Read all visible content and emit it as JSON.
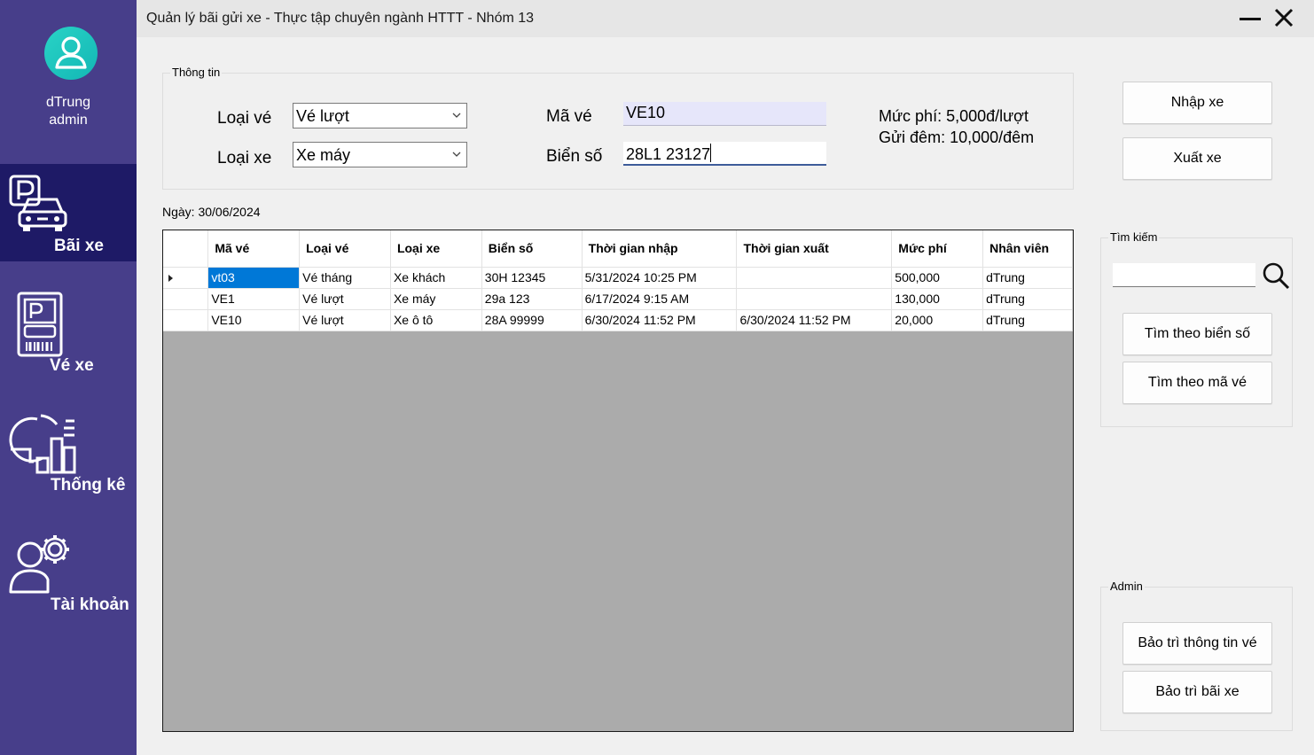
{
  "sidebar": {
    "user_name": "dTrung",
    "user_role": "admin",
    "items": [
      {
        "label": "Bãi xe",
        "icon": "parking-car-icon",
        "active": true
      },
      {
        "label": "Vé xe",
        "icon": "parking-ticket-icon",
        "active": false
      },
      {
        "label": "Thống kê",
        "icon": "statistics-chart-icon",
        "active": false
      },
      {
        "label": "Tài khoản",
        "icon": "user-settings-icon",
        "active": false
      }
    ]
  },
  "window": {
    "title": "Quản lý bãi gửi xe - Thực tập chuyên ngành HTTT - Nhóm 13"
  },
  "info": {
    "legend": "Thông tin",
    "ticket_type_label": "Loại vé",
    "ticket_type_value": "Vé lượt",
    "vehicle_type_label": "Loại xe",
    "vehicle_type_value": "Xe máy",
    "ticket_id_label": "Mã vé",
    "ticket_id_value": "VE10",
    "plate_label": "Biển số",
    "plate_value": "28L1 23127",
    "fee_rate": "Mức phí: 5,000đ/lượt",
    "night_fee": "Gửi đêm: 10,000/đêm"
  },
  "actions": {
    "check_in": "Nhập xe",
    "check_out": "Xuất xe"
  },
  "date_label": "Ngày: 30/06/2024",
  "table": {
    "columns": [
      "Mã vé",
      "Loại vé",
      "Loại xe",
      "Biển số",
      "Thời gian nhập",
      "Thời gian xuất",
      "Mức phí",
      "Nhân viên"
    ],
    "rows": [
      [
        "vt03",
        "Vé tháng",
        "Xe khách",
        "30H 12345",
        "5/31/2024 10:25 PM",
        "",
        "500,000",
        "dTrung"
      ],
      [
        "VE1",
        "Vé lượt",
        "Xe máy",
        "29a 123",
        "6/17/2024 9:15 AM",
        "",
        "130,000",
        "dTrung"
      ],
      [
        "VE10",
        "Vé lượt",
        "Xe ô tô",
        "28A 99999",
        "6/30/2024 11:52 PM",
        "6/30/2024 11:52 PM",
        "20,000",
        "dTrung"
      ]
    ]
  },
  "search": {
    "legend": "Tìm kiếm",
    "value": "",
    "by_plate": "Tìm theo biển số",
    "by_ticket": "Tìm theo mã vé"
  },
  "admin": {
    "legend": "Admin",
    "maintain_tickets": "Bảo trì thông tin vé",
    "maintain_lot": "Bảo trì bãi xe"
  },
  "colors": {
    "sidebar_bg": "#473e8a",
    "sidebar_active": "#1e1a66",
    "avatar": "#1fc4bd",
    "selection": "#0078d7",
    "readonly_field": "#e6e6fa"
  }
}
